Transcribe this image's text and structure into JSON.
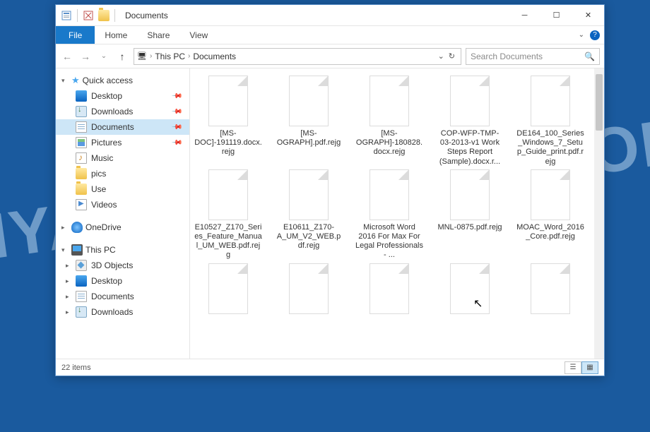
{
  "window": {
    "title": "Documents"
  },
  "ribbon": {
    "file": "File",
    "tabs": [
      "Home",
      "Share",
      "View"
    ]
  },
  "address": {
    "root_glyph": "🖥",
    "segments": [
      "This PC",
      "Documents"
    ]
  },
  "search": {
    "placeholder": "Search Documents"
  },
  "sidebar": {
    "quick_access": {
      "label": "Quick access",
      "items": [
        {
          "label": "Desktop",
          "icon": "desktop",
          "pinned": true
        },
        {
          "label": "Downloads",
          "icon": "downloads",
          "pinned": true
        },
        {
          "label": "Documents",
          "icon": "documents",
          "pinned": true,
          "selected": true
        },
        {
          "label": "Pictures",
          "icon": "pictures",
          "pinned": true
        },
        {
          "label": "Music",
          "icon": "music"
        },
        {
          "label": "pics",
          "icon": "folder"
        },
        {
          "label": "Use",
          "icon": "folder"
        },
        {
          "label": "Videos",
          "icon": "videos"
        }
      ]
    },
    "onedrive": {
      "label": "OneDrive"
    },
    "this_pc": {
      "label": "This PC",
      "items": [
        {
          "label": "3D Objects",
          "icon": "obj3d"
        },
        {
          "label": "Desktop",
          "icon": "desktop"
        },
        {
          "label": "Documents",
          "icon": "documents"
        },
        {
          "label": "Downloads",
          "icon": "downloads"
        }
      ]
    }
  },
  "files": [
    {
      "name": "[MS-DOC]-191119.docx.rejg"
    },
    {
      "name": "[MS-OGRAPH].pdf.rejg"
    },
    {
      "name": "[MS-OGRAPH]-180828.docx.rejg"
    },
    {
      "name": "COP-WFP-TMP-03-2013-v1 Work Steps Report (Sample).docx.r..."
    },
    {
      "name": "DE164_100_Series_Windows_7_Setup_Guide_print.pdf.rejg"
    },
    {
      "name": "E10527_Z170_Series_Feature_Manual_UM_WEB.pdf.rejg"
    },
    {
      "name": "E10611_Z170-A_UM_V2_WEB.pdf.rejg"
    },
    {
      "name": "Microsoft Word 2016 For Max For Legal Professionals - ..."
    },
    {
      "name": "MNL-0875.pdf.rejg"
    },
    {
      "name": "MOAC_Word_2016_Core.pdf.rejg"
    },
    {
      "name": ""
    },
    {
      "name": ""
    },
    {
      "name": ""
    },
    {
      "name": ""
    },
    {
      "name": ""
    }
  ],
  "status": {
    "count_text": "22 items"
  },
  "watermark": "MYANTISPYWARE.COM"
}
